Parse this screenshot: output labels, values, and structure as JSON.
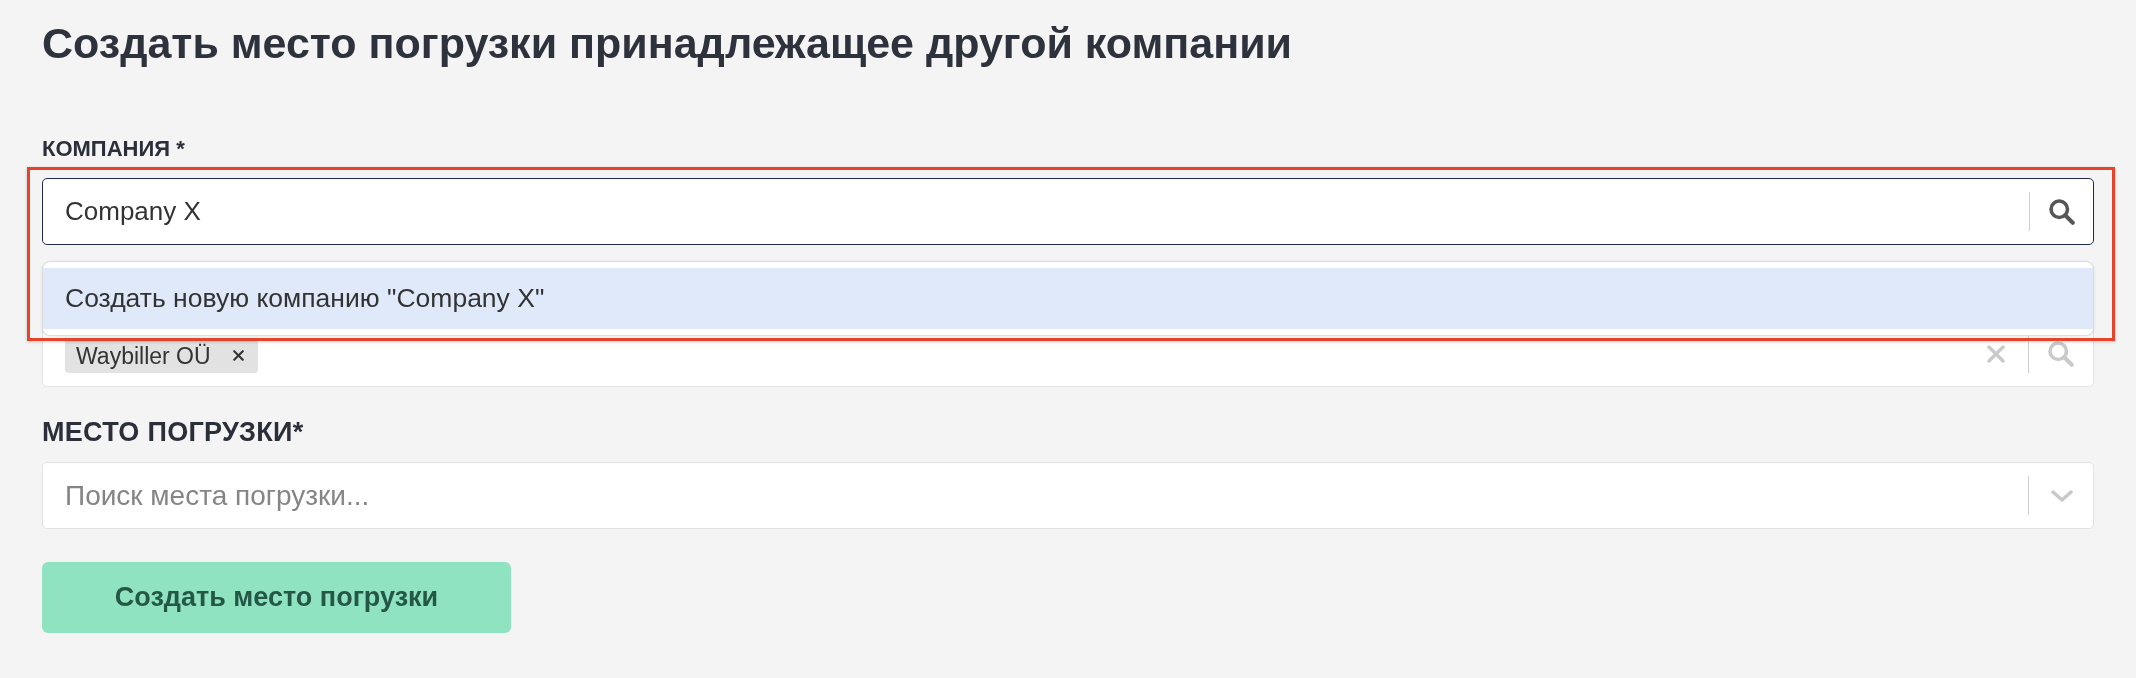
{
  "title": "Создать место погрузки принадлежащее другой компании",
  "company": {
    "label": "КОМПАНИЯ *",
    "value": "Company X",
    "focused": true,
    "highlighted": true,
    "options": [
      {
        "label": "Создать новую компанию \"Company X\"",
        "selected": true
      }
    ]
  },
  "field_2": {
    "tags": [
      {
        "label": "Waybiller OÜ"
      }
    ]
  },
  "loading_place": {
    "label": "МЕСТО ПОГРУЗКИ*",
    "placeholder": "Поиск места погрузки...",
    "focused": false
  },
  "submit_button": {
    "label": "Создать место погрузки"
  }
}
